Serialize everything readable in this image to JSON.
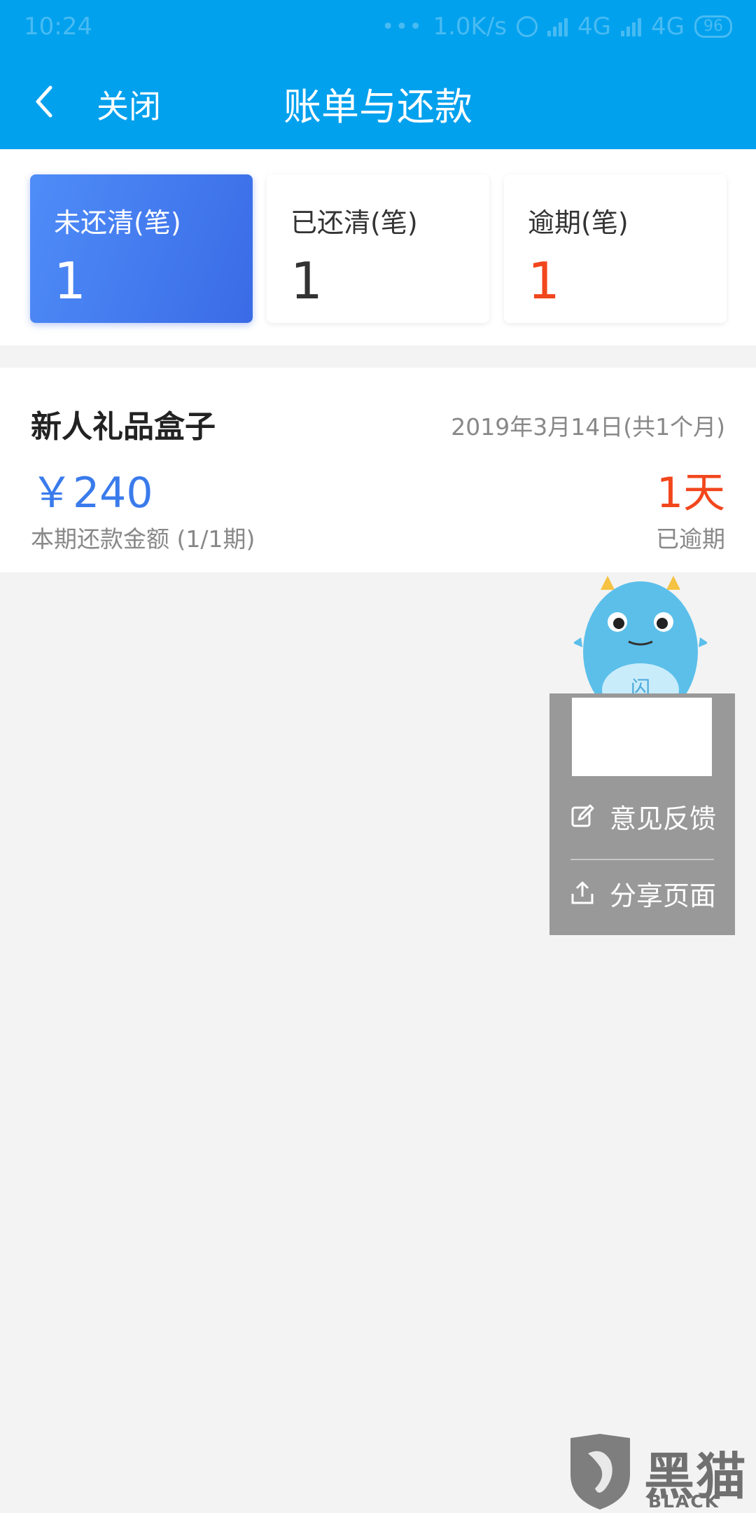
{
  "status_bar": {
    "time": "10:24",
    "dots": "•••",
    "net_speed": "1.0K/s",
    "network_1": "4G",
    "network_2": "4G",
    "battery": "96"
  },
  "header": {
    "close_label": "关闭",
    "title": "账单与还款"
  },
  "summary": {
    "cards": [
      {
        "label": "未还清(笔)",
        "count": "1"
      },
      {
        "label": "已还清(笔)",
        "count": "1"
      },
      {
        "label": "逾期(笔)",
        "count": "1"
      }
    ]
  },
  "bill": {
    "name": "新人礼品盒子",
    "date": "2019年3月14日(共1个月)",
    "amount": "￥240",
    "amount_caption": "本期还款金额 (1/1期)",
    "overdue_days": "1天",
    "overdue_status": "已逾期"
  },
  "float_menu": {
    "mascot_badge": "闪",
    "feedback_label": "意见反馈",
    "share_label": "分享页面"
  },
  "watermark": {
    "text": "黑猫",
    "sub": "BLACK CAT"
  },
  "colors": {
    "header_bg": "#02a1ee",
    "active_card": "#3a6be6",
    "amount": "#3a7bec",
    "overdue": "#f2461d"
  }
}
